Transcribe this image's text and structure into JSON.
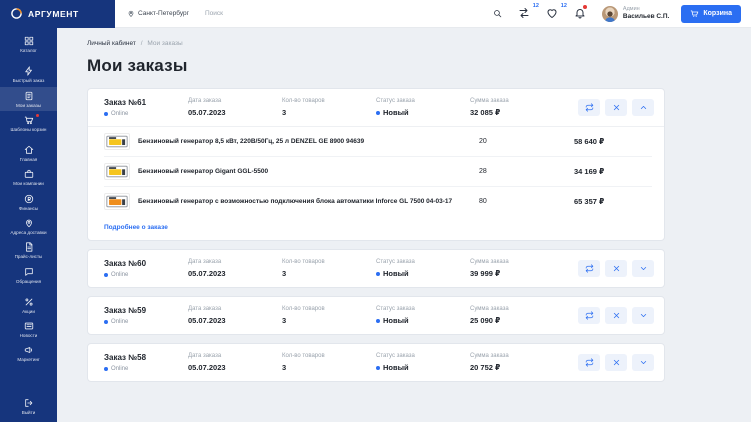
{
  "brand": {
    "name": "АРГУМЕНТ",
    "city": "Санкт-Петербург"
  },
  "header": {
    "search_placeholder": "Поиск",
    "compare_count": "12",
    "favorites_count": "12",
    "user_role": "Админ",
    "user_name": "Васильев С.П.",
    "cart_label": "Корзина"
  },
  "sidebar": {
    "items": [
      {
        "id": "catalog",
        "label": "Каталог",
        "icon": "grid-icon",
        "gap_after": true
      },
      {
        "id": "quick-order",
        "label": "Быстрый заказ",
        "icon": "bolt-icon"
      },
      {
        "id": "my-orders",
        "label": "Мои заказы",
        "icon": "orders-icon",
        "active": true
      },
      {
        "id": "cart-templates",
        "label": "Шаблоны корзин",
        "icon": "cart-icon",
        "badge": true,
        "gap_after": true
      },
      {
        "id": "home",
        "label": "Главная",
        "icon": "home-icon"
      },
      {
        "id": "my-companies",
        "label": "Мои компании",
        "icon": "company-icon"
      },
      {
        "id": "finance",
        "label": "Финансы",
        "icon": "finance-icon"
      },
      {
        "id": "delivery-addresses",
        "label": "Адреса доставки",
        "icon": "pin-icon"
      },
      {
        "id": "price-lists",
        "label": "Прайс-листы",
        "icon": "doc-icon"
      },
      {
        "id": "support",
        "label": "Обращения",
        "icon": "chat-icon",
        "gap_after": true
      },
      {
        "id": "promotions",
        "label": "Акции",
        "icon": "percent-icon"
      },
      {
        "id": "news",
        "label": "Новости",
        "icon": "news-icon"
      },
      {
        "id": "marketing",
        "label": "Маркетинг",
        "icon": "megaphone-icon"
      },
      {
        "id": "logout",
        "label": "Выйти",
        "icon": "logout-icon"
      }
    ]
  },
  "breadcrumb": {
    "home": "Личный кабинет",
    "separator": "/",
    "current": "Мои заказы"
  },
  "page_title": "Мои заказы",
  "order_columns": {
    "date": "Дата заказа",
    "qty": "Кол-во товаров",
    "status": "Статус заказа",
    "sum": "Сумма заказа"
  },
  "orders": [
    {
      "number": "Заказ №61",
      "channel": "Online",
      "date": "05.07.2023",
      "qty": "3",
      "status": "Новый",
      "sum": "32 085 ₽",
      "expanded": true,
      "details_link": "Подробнее о заказе",
      "items": [
        {
          "name": "Бензиновый генератор 8,5 кВт, 220В/50Гц, 25 л DENZEL GE 8900 94639",
          "qty": "20",
          "price": "58 640 ₽",
          "thumb_color": "#f5c51e"
        },
        {
          "name": "Бензиновый генератор Gigant GGL-5500",
          "qty": "28",
          "price": "34 169 ₽",
          "thumb_color": "#f5c51e"
        },
        {
          "name": "Бензиновый генератор с возможностью подключения блока автоматики Inforce GL 7500 04-03-17",
          "qty": "80",
          "price": "65 357 ₽",
          "thumb_color": "#ef8e1d"
        }
      ]
    },
    {
      "number": "Заказ №60",
      "channel": "Online",
      "date": "05.07.2023",
      "qty": "3",
      "status": "Новый",
      "sum": "39 999 ₽",
      "expanded": false
    },
    {
      "number": "Заказ №59",
      "channel": "Online",
      "date": "05.07.2023",
      "qty": "3",
      "status": "Новый",
      "sum": "25 090 ₽",
      "expanded": false
    },
    {
      "number": "Заказ №58",
      "channel": "Online",
      "date": "05.07.2023",
      "qty": "3",
      "status": "Новый",
      "sum": "20 752 ₽",
      "expanded": false
    }
  ],
  "colors": {
    "accent": "#2b6ef2",
    "sidebar": "#16357d",
    "badge": "#e53935",
    "status_dot": "#2b6ef2"
  }
}
